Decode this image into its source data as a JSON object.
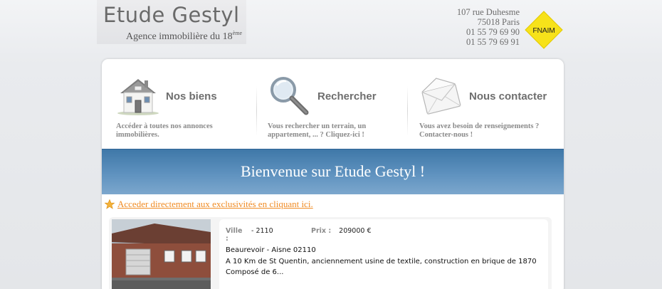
{
  "header": {
    "title": "Etude Gestyl",
    "subtitle": "Agence immobilière du 18",
    "subtitle_sup": "ème",
    "address_lines": [
      "107 rue Duhesme",
      "75018 Paris",
      "01 55 79 69 90",
      "01 55 79 69 91"
    ],
    "badge": "FNAIM",
    "badge_color": "#f7e21a"
  },
  "features": [
    {
      "title": "Nos biens",
      "description_lines": [
        "Accéder à toutes nos annonces",
        "immobilières."
      ],
      "icon": "house-icon"
    },
    {
      "title": "Rechercher",
      "description_lines": [
        "Vous rechercher un terrain, un",
        "appartement, ... ? Cliquez-ici !"
      ],
      "icon": "magnifier-icon"
    },
    {
      "title": "Nous contacter",
      "description_lines": [
        "Vous avez besoin de renseignements ?",
        "Contacter-nous !"
      ],
      "icon": "envelope-icon"
    }
  ],
  "banner": {
    "text": "Bienvenue sur Etude Gestyl !",
    "color": "#4f86b6"
  },
  "exclusivities_link": "Acceder directement aux exclusivités en cliquant ici.",
  "listing": {
    "ville_label": "Ville",
    "ville_colon": ":",
    "ville_value": "- 2110",
    "prix_label": "Prix :",
    "prix_value": "209000 €",
    "location": "Beaurevoir - Aisne 02110",
    "description_lines": [
      "A 10 Km de St Quentin, anciennement usine de textile, construction en brique de 1870",
      "Composé de 6..."
    ]
  }
}
